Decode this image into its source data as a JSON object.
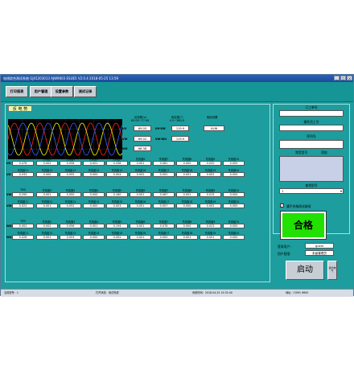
{
  "window": {
    "title": "电线综合测试系统 GJ41203013 AJW9003 ESUE5 V2.0.4 2018-05-25 13:59",
    "buttons": [
      "_",
      "□",
      "×"
    ]
  },
  "toolbar": [
    "打印报表",
    "用户管理",
    "设置参数",
    "测试记录"
  ],
  "section_label": "反 电 势",
  "back_emf": {
    "header_line1": "反电势(V)",
    "header_line2": "65.00~77.00",
    "phase_header_line1": "相位角(°)",
    "phase_header_line2": "0.0~360.0",
    "phase_order_header": "相序设置",
    "phase_order_value": "UVW",
    "rows": [
      {
        "label": "UV",
        "value": "69.05",
        "phase_label": "UV-VW",
        "phase": "119.9"
      },
      {
        "label": "VW",
        "value": "69.02",
        "phase_label": "VW-WU",
        "phase": "119.9"
      },
      {
        "label": "WU",
        "value": "68.38"
      }
    ]
  },
  "harmonics": {
    "groups": [
      {
        "label": "UV",
        "row1_headers": [
          "THD",
          "失真度2",
          "失真度3",
          "失真度4",
          "失真度5",
          "失真度6",
          "失真度7",
          "失真度8",
          "失真度9",
          "失真度10"
        ],
        "row1_values": [
          "0.476",
          "0.002",
          "0.056",
          "0.001",
          "0.336",
          "0.001",
          "0.081",
          "0.000",
          "0.020",
          "0.000"
        ],
        "row2_headers": [
          "失真度11",
          "失真度12",
          "失真度13",
          "失真度14",
          "失真度15",
          "失真度16",
          "失真度17",
          "失真度18",
          "失真度19",
          "失真度20"
        ],
        "row2_values": [
          "0.033",
          "0.000",
          "0.055",
          "0.000",
          "0.004",
          "0.002",
          "0.002",
          "0.001",
          "0.002",
          "0.000"
        ]
      },
      {
        "label": "VW",
        "row1_headers": [
          "THD",
          "失真度2",
          "失真度3",
          "失真度4",
          "失真度5",
          "失真度6",
          "失真度7",
          "失真度8",
          "失真度9",
          "失真度10"
        ],
        "row1_values": [
          "0.290",
          "0.001",
          "0.050",
          "0.000",
          "0.160",
          "0.001",
          "0.067",
          "0.001",
          "0.015",
          "0.000"
        ],
        "row2_headers": [
          "失真度11",
          "失真度12",
          "失真度13",
          "失真度14",
          "失真度15",
          "失真度16",
          "失真度17",
          "失真度18",
          "失真度19",
          "失真度20"
        ],
        "row2_values": [
          "0.022",
          "0.001",
          "0.052",
          "0.000",
          "0.003",
          "0.001",
          "0.007",
          "0.000",
          "0.002",
          "0.000"
        ]
      },
      {
        "label": "WU",
        "row1_headers": [
          "THD",
          "失真度2",
          "失真度3",
          "失真度4",
          "失真度5",
          "失真度6",
          "失真度7",
          "失真度8",
          "失真度9",
          "失真度10"
        ],
        "row1_values": [
          "0.452",
          "0.002",
          "0.056",
          "0.001",
          "0.194",
          "0.001",
          "0.078",
          "0.000",
          "0.023",
          "0.000"
        ],
        "row2_headers": [
          "失真度11",
          "失真度12",
          "失真度13",
          "失真度14",
          "失真度15",
          "失真度16",
          "失真度17",
          "失真度18",
          "失真度19",
          "失真度20"
        ],
        "row2_values": [
          "0.028",
          "0.001",
          "0.053",
          "0.000",
          "0.002",
          "0.001",
          "0.005",
          "0.001",
          "0.001",
          "0.000"
        ]
      }
    ]
  },
  "right_panel": {
    "work_order_label": "订工单号",
    "operator_label": "操作员工号",
    "serial_label": "序列号",
    "common_model_label": "常用型号",
    "common_model_extra": "添加",
    "query_model_label": "查找型号",
    "query_model_value": "1",
    "checkbox_label": "遇不合格测试继续",
    "result": "合格",
    "login_user_label": "登录用户：",
    "login_user_value": "guest",
    "permission_label": "用户权限：",
    "permission_value": "未级管理员",
    "start_button": "启动",
    "small_button": "退出电气"
  },
  "statusbar": {
    "items": [
      "当前型号：1",
      "打开状态：测试完成",
      "系统时间：2018-04-25 15:32:40",
      "地址：COM1 9600"
    ]
  },
  "colors": {
    "window_bg": "#1d9d9d",
    "pass_green": "#22e000",
    "wave_red": "#ff2020",
    "wave_yellow": "#ffff00",
    "wave_blue": "#3060ff"
  }
}
